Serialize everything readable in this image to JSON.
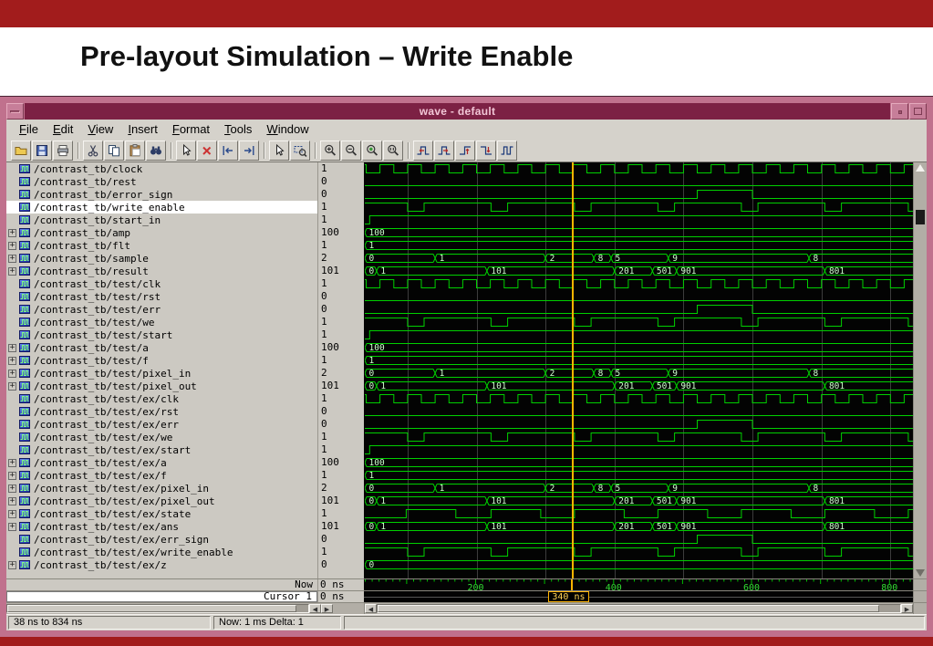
{
  "slide": {
    "title": "Pre-layout Simulation – Write Enable",
    "accent_color": "#a21c1c"
  },
  "icons": {
    "expander_plus": "+",
    "left_arrow": "◀",
    "right_arrow": "▶"
  },
  "window": {
    "title": "wave - default",
    "menus": [
      "File",
      "Edit",
      "View",
      "Insert",
      "Format",
      "Tools",
      "Window"
    ],
    "toolbar": [
      {
        "name": "open-button",
        "icon": "open-folder-icon"
      },
      {
        "name": "save-button",
        "icon": "save-floppy-icon"
      },
      {
        "name": "print-button",
        "icon": "printer-icon"
      },
      {
        "sep": true
      },
      {
        "name": "cut-button",
        "icon": "scissors-icon"
      },
      {
        "name": "copy-button",
        "icon": "copy-icon"
      },
      {
        "name": "paste-button",
        "icon": "paste-icon"
      },
      {
        "name": "find-button",
        "icon": "binoculars-icon"
      },
      {
        "sep": true
      },
      {
        "name": "select-cursor-button",
        "icon": "pointer-icon"
      },
      {
        "name": "delete-cursor-button",
        "icon": "delete-x-icon"
      },
      {
        "name": "find-previous-button",
        "icon": "find-previous-icon"
      },
      {
        "name": "find-next-button",
        "icon": "find-next-icon"
      },
      {
        "sep": true
      },
      {
        "name": "select-mode-button",
        "icon": "select-mode-icon"
      },
      {
        "name": "zoom-mode-button",
        "icon": "zoom-mode-icon"
      },
      {
        "sep": true
      },
      {
        "name": "zoom-in-button",
        "icon": "zoom-in-icon"
      },
      {
        "name": "zoom-out-button",
        "icon": "zoom-out-icon"
      },
      {
        "name": "zoom-full-button",
        "icon": "zoom-full-icon"
      },
      {
        "name": "zoom-range-button",
        "icon": "zoom-range-icon"
      },
      {
        "sep": true
      },
      {
        "name": "find-previous-edge-button",
        "icon": "edge-prev-icon"
      },
      {
        "name": "find-next-edge-button",
        "icon": "edge-next-icon"
      },
      {
        "name": "find-rising-edge-button",
        "icon": "edge-rise-icon"
      },
      {
        "name": "find-falling-edge-button",
        "icon": "edge-fall-icon"
      },
      {
        "name": "find-any-edge-button",
        "icon": "edge-both-icon"
      }
    ],
    "footer": {
      "now_label": "Now",
      "now_value": "0 ns",
      "cursor_label": "Cursor 1",
      "cursor_value": "0 ns"
    },
    "status": {
      "range": "38 ns to 834 ns",
      "now": "Now: 1 ms  Delta: 1"
    }
  },
  "wave": {
    "time_start": 38,
    "time_end": 834,
    "cursor_time": 340,
    "cursor_label": "340 ns",
    "grid_start": 100,
    "grid_interval": 100,
    "ruler_labels": [
      200,
      400,
      600,
      800
    ],
    "colors": {
      "wave": "#00d000",
      "bus_text": "#ccffcc",
      "cursor": "#ffb400",
      "grid": "#3c3c3c",
      "background": "#030303",
      "ruler_text": "#33dd33"
    },
    "wave_defs": {
      "clk": {
        "kind": "clock",
        "initial": 1,
        "first_toggle": 40,
        "half_period": 20
      },
      "low": {
        "kind": "level",
        "initial": 0,
        "toggles": []
      },
      "err": {
        "kind": "level",
        "initial": 0,
        "toggles": [
          520,
          600
        ]
      },
      "we": {
        "kind": "level",
        "initial": 1,
        "toggles": [
          100,
          124,
          221,
          245,
          342,
          366,
          463,
          487,
          584,
          608,
          705,
          729,
          826
        ]
      },
      "start": {
        "kind": "level",
        "initial": 0,
        "toggles": [
          45
        ]
      },
      "state": {
        "kind": "level",
        "initial": 0,
        "toggles": [
          98,
          170,
          221,
          293,
          342,
          414,
          463,
          535,
          584,
          656,
          705,
          777,
          826
        ]
      },
      "bus100": {
        "kind": "bus",
        "segments": [
          [
            38,
            "100"
          ]
        ]
      },
      "bus1": {
        "kind": "bus",
        "segments": [
          [
            38,
            "1"
          ]
        ]
      },
      "bus0": {
        "kind": "bus",
        "segments": [
          [
            38,
            "0"
          ]
        ]
      },
      "sample": {
        "kind": "bus",
        "segments": [
          [
            38,
            "0"
          ],
          [
            140,
            "1"
          ],
          [
            300,
            "2"
          ],
          [
            370,
            "8"
          ],
          [
            395,
            "5"
          ],
          [
            478,
            "9"
          ],
          [
            682,
            "8"
          ]
        ]
      },
      "result": {
        "kind": "bus",
        "segments": [
          [
            38,
            "0"
          ],
          [
            55,
            "1"
          ],
          [
            215,
            "101"
          ],
          [
            400,
            "201"
          ],
          [
            455,
            "501"
          ],
          [
            490,
            "901"
          ],
          [
            705,
            "801"
          ]
        ]
      }
    },
    "signals": [
      {
        "name": "/contrast_tb/clock",
        "value": "1",
        "expand": false,
        "wave": "clk"
      },
      {
        "name": "/contrast_tb/rest",
        "value": "0",
        "expand": false,
        "wave": "low"
      },
      {
        "name": "/contrast_tb/error_sign",
        "value": "0",
        "expand": false,
        "wave": "err"
      },
      {
        "name": "/contrast_tb/write_enable",
        "value": "1",
        "expand": false,
        "wave": "we",
        "selected": true
      },
      {
        "name": "/contrast_tb/start_in",
        "value": "1",
        "expand": false,
        "wave": "start"
      },
      {
        "name": "/contrast_tb/amp",
        "value": "100",
        "expand": true,
        "wave": "bus100"
      },
      {
        "name": "/contrast_tb/flt",
        "value": "1",
        "expand": true,
        "wave": "bus1"
      },
      {
        "name": "/contrast_tb/sample",
        "value": "2",
        "expand": true,
        "wave": "sample"
      },
      {
        "name": "/contrast_tb/result",
        "value": "101",
        "expand": true,
        "wave": "result"
      },
      {
        "name": "/contrast_tb/test/clk",
        "value": "1",
        "expand": false,
        "wave": "clk"
      },
      {
        "name": "/contrast_tb/test/rst",
        "value": "0",
        "expand": false,
        "wave": "low"
      },
      {
        "name": "/contrast_tb/test/err",
        "value": "0",
        "expand": false,
        "wave": "err"
      },
      {
        "name": "/contrast_tb/test/we",
        "value": "1",
        "expand": false,
        "wave": "we"
      },
      {
        "name": "/contrast_tb/test/start",
        "value": "1",
        "expand": false,
        "wave": "start"
      },
      {
        "name": "/contrast_tb/test/a",
        "value": "100",
        "expand": true,
        "wave": "bus100"
      },
      {
        "name": "/contrast_tb/test/f",
        "value": "1",
        "expand": true,
        "wave": "bus1"
      },
      {
        "name": "/contrast_tb/test/pixel_in",
        "value": "2",
        "expand": true,
        "wave": "sample"
      },
      {
        "name": "/contrast_tb/test/pixel_out",
        "value": "101",
        "expand": true,
        "wave": "result"
      },
      {
        "name": "/contrast_tb/test/ex/clk",
        "value": "1",
        "expand": false,
        "wave": "clk"
      },
      {
        "name": "/contrast_tb/test/ex/rst",
        "value": "0",
        "expand": false,
        "wave": "low"
      },
      {
        "name": "/contrast_tb/test/ex/err",
        "value": "0",
        "expand": false,
        "wave": "err"
      },
      {
        "name": "/contrast_tb/test/ex/we",
        "value": "1",
        "expand": false,
        "wave": "we"
      },
      {
        "name": "/contrast_tb/test/ex/start",
        "value": "1",
        "expand": false,
        "wave": "start"
      },
      {
        "name": "/contrast_tb/test/ex/a",
        "value": "100",
        "expand": true,
        "wave": "bus100"
      },
      {
        "name": "/contrast_tb/test/ex/f",
        "value": "1",
        "expand": true,
        "wave": "bus1"
      },
      {
        "name": "/contrast_tb/test/ex/pixel_in",
        "value": "2",
        "expand": true,
        "wave": "sample"
      },
      {
        "name": "/contrast_tb/test/ex/pixel_out",
        "value": "101",
        "expand": true,
        "wave": "result"
      },
      {
        "name": "/contrast_tb/test/ex/state",
        "value": "1",
        "expand": true,
        "wave": "state"
      },
      {
        "name": "/contrast_tb/test/ex/ans",
        "value": "101",
        "expand": true,
        "wave": "result"
      },
      {
        "name": "/contrast_tb/test/ex/err_sign",
        "value": "0",
        "expand": false,
        "wave": "err"
      },
      {
        "name": "/contrast_tb/test/ex/write_enable",
        "value": "1",
        "expand": false,
        "wave": "we"
      },
      {
        "name": "/contrast_tb/test/ex/z",
        "value": "0",
        "expand": true,
        "wave": "bus0"
      }
    ]
  }
}
